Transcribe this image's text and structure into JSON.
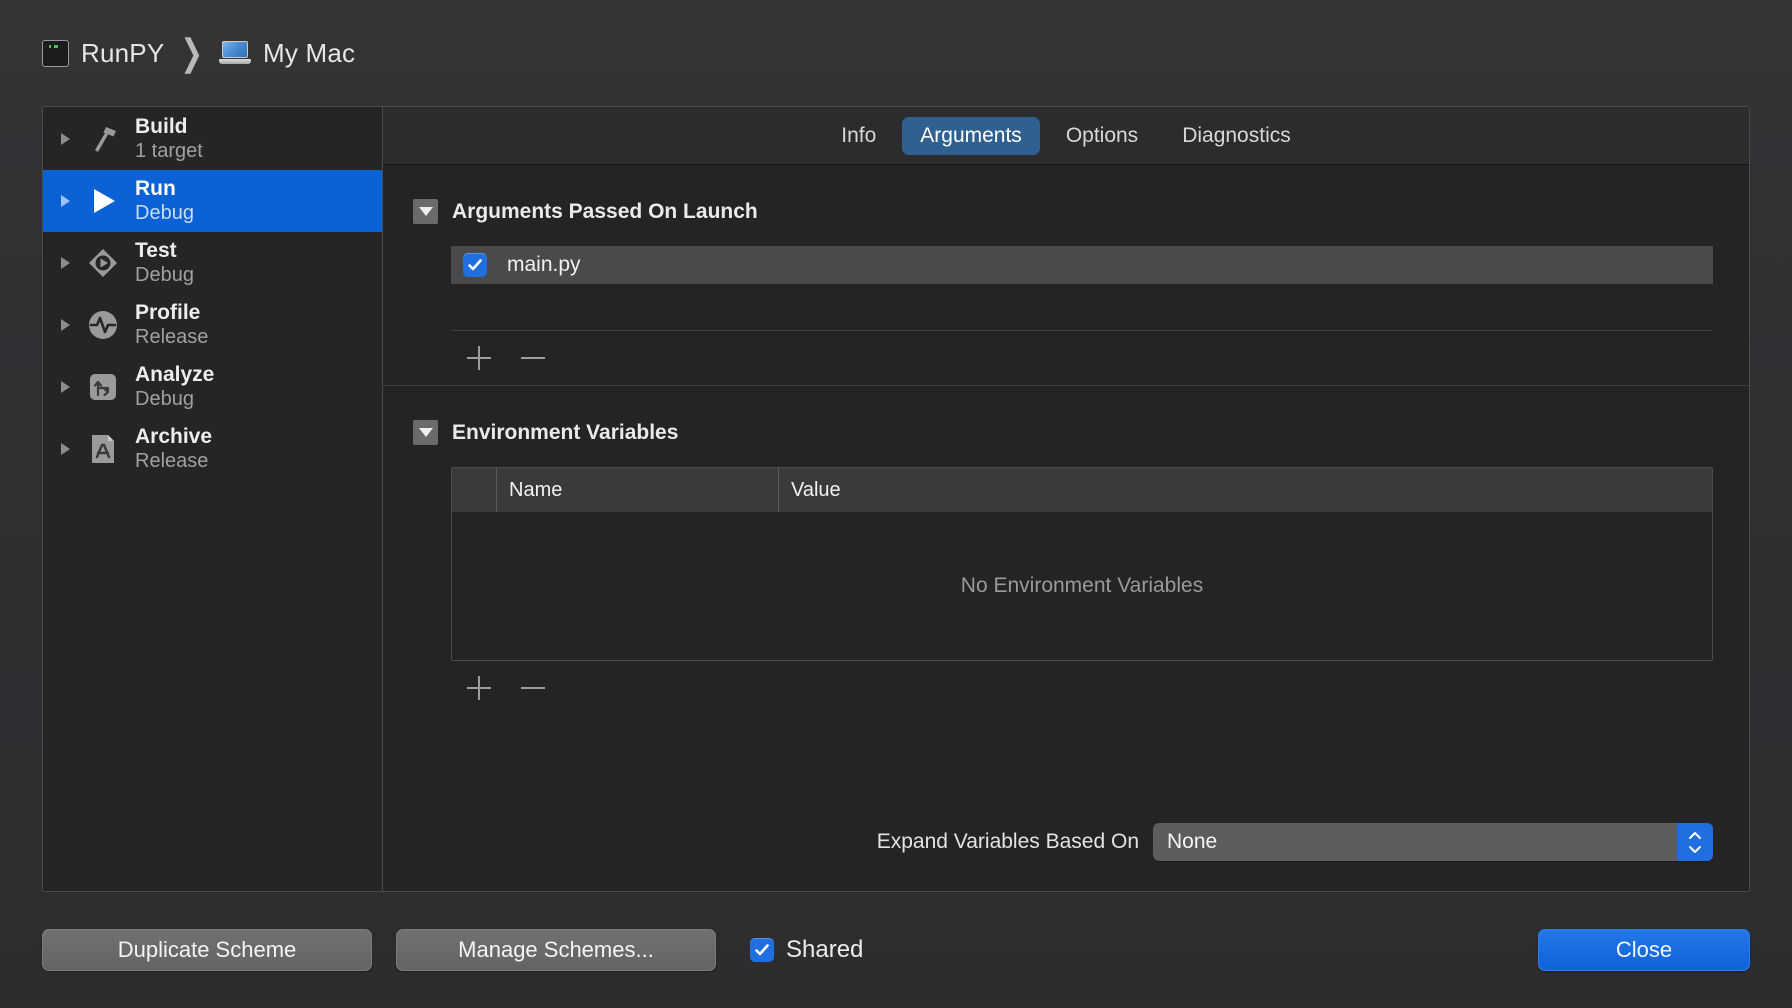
{
  "breadcrumb": {
    "scheme_icon": "terminal-icon",
    "scheme_name": "RunPY",
    "separator": "❯",
    "destination_icon": "laptop-icon",
    "destination_name": "My Mac"
  },
  "sidebar": {
    "items": [
      {
        "title": "Build",
        "subtitle": "1 target",
        "icon": "hammer-icon",
        "selected": false
      },
      {
        "title": "Run",
        "subtitle": "Debug",
        "icon": "play-icon",
        "selected": true
      },
      {
        "title": "Test",
        "subtitle": "Debug",
        "icon": "test-diamond-icon",
        "selected": false
      },
      {
        "title": "Profile",
        "subtitle": "Release",
        "icon": "profile-pulse-icon",
        "selected": false
      },
      {
        "title": "Analyze",
        "subtitle": "Debug",
        "icon": "analyze-arrow-icon",
        "selected": false
      },
      {
        "title": "Archive",
        "subtitle": "Release",
        "icon": "archive-doc-icon",
        "selected": false
      }
    ]
  },
  "tabs": [
    {
      "label": "Info",
      "active": false
    },
    {
      "label": "Arguments",
      "active": true
    },
    {
      "label": "Options",
      "active": false
    },
    {
      "label": "Diagnostics",
      "active": false
    }
  ],
  "arguments_section": {
    "title": "Arguments Passed On Launch",
    "expanded": true,
    "items": [
      {
        "label": "main.py",
        "checked": true
      }
    ],
    "add_label": "+",
    "remove_label": "−"
  },
  "environment_section": {
    "title": "Environment Variables",
    "expanded": true,
    "columns": [
      "Name",
      "Value"
    ],
    "rows": [],
    "empty_message": "No Environment Variables",
    "add_label": "+",
    "remove_label": "−"
  },
  "expand_variables": {
    "label": "Expand Variables Based On",
    "value": "None",
    "options": [
      "None"
    ]
  },
  "footer": {
    "duplicate_scheme": "Duplicate Scheme",
    "manage_schemes": "Manage Schemes...",
    "shared_label": "Shared",
    "shared_checked": true,
    "close": "Close"
  },
  "colors": {
    "accent_blue": "#0b62d6",
    "tab_active": "#2f6090",
    "checkbox_blue": "#1f6fe0",
    "window_bg": "#303033",
    "panel_bg": "#242426",
    "sidebar_bg": "#252527"
  }
}
